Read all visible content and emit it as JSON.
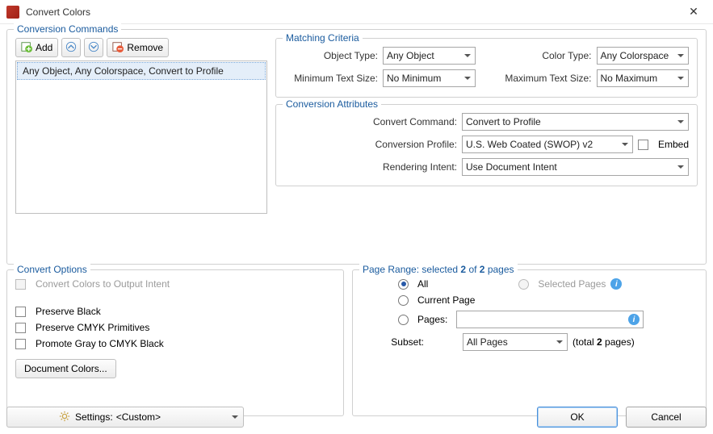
{
  "window": {
    "title": "Convert Colors"
  },
  "conversion_commands": {
    "legend": "Conversion Commands",
    "toolbar": {
      "add": "Add",
      "remove": "Remove"
    },
    "list": {
      "item0": "Any Object, Any Colorspace, Convert to Profile"
    }
  },
  "matching": {
    "legend": "Matching Criteria",
    "object_type_label": "Object Type:",
    "object_type_value": "Any Object",
    "color_type_label": "Color Type:",
    "color_type_value": "Any Colorspace",
    "min_text_label": "Minimum Text Size:",
    "min_text_value": "No Minimum",
    "max_text_label": "Maximum Text Size:",
    "max_text_value": "No Maximum"
  },
  "attributes": {
    "legend": "Conversion Attributes",
    "convert_cmd_label": "Convert Command:",
    "convert_cmd_value": "Convert to Profile",
    "profile_label": "Conversion Profile:",
    "profile_value": "U.S. Web Coated (SWOP) v2",
    "embed_label": "Embed",
    "intent_label": "Rendering Intent:",
    "intent_value": "Use Document Intent"
  },
  "options": {
    "legend": "Convert Options",
    "to_output_intent": "Convert Colors to Output Intent",
    "preserve_black": "Preserve Black",
    "preserve_cmyk": "Preserve CMYK Primitives",
    "promote_gray": "Promote Gray to CMYK Black",
    "doc_colors": "Document Colors..."
  },
  "page_range": {
    "legend_prefix": "Page Range: selected ",
    "selected": "2",
    "of_word": " of ",
    "total": "2",
    "legend_suffix": " pages",
    "all": "All",
    "selected_pages": "Selected Pages",
    "current_page": "Current Page",
    "pages": "Pages:",
    "subset_label": "Subset:",
    "subset_value": "All Pages",
    "total_prefix": "(total ",
    "total_value": "2",
    "total_suffix": " pages)"
  },
  "footer": {
    "settings_label": "Settings:",
    "settings_value": "<Custom>",
    "ok": "OK",
    "cancel": "Cancel"
  }
}
